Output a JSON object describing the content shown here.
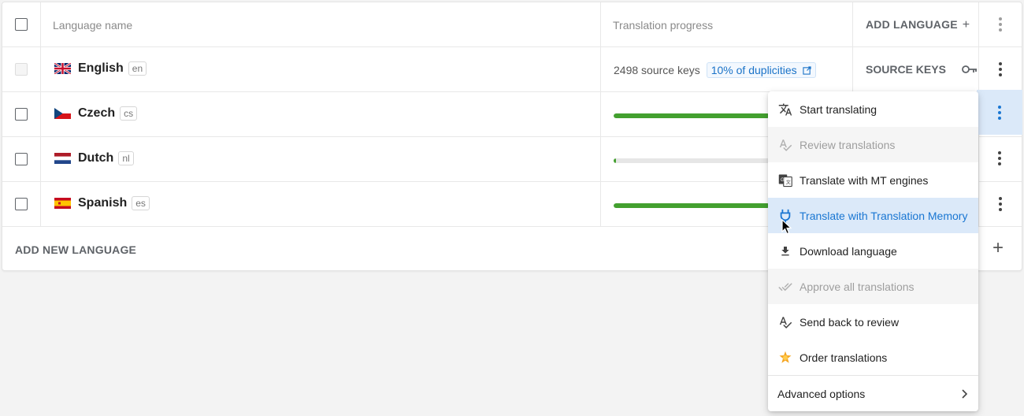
{
  "header": {
    "language_name": "Language name",
    "translation_progress": "Translation progress",
    "add_language": "ADD LANGUAGE",
    "add_icon": "+"
  },
  "rows": [
    {
      "name": "English",
      "code": "en",
      "flag": "uk-flag",
      "source_keys": "2498 source keys",
      "duplicities": "10% of duplicities",
      "source_keys_button": "SOURCE KEYS"
    },
    {
      "name": "Czech",
      "code": "cs",
      "flag": "cz-flag",
      "progress": 0.66
    },
    {
      "name": "Dutch",
      "code": "nl",
      "flag": "nl-flag",
      "progress": 0.01
    },
    {
      "name": "Spanish",
      "code": "es",
      "flag": "es-flag",
      "progress": 0.66
    }
  ],
  "add_new_language": "ADD NEW LANGUAGE",
  "add_new_icon": "+",
  "menu": {
    "items": [
      {
        "label": "Start translating",
        "icon": "translate-icon",
        "state": "normal"
      },
      {
        "label": "Review translations",
        "icon": "spellcheck-icon",
        "state": "disabled"
      },
      {
        "label": "Translate with MT engines",
        "icon": "google-translate-icon",
        "state": "normal"
      },
      {
        "label": "Translate with Translation Memory",
        "icon": "plug-icon",
        "state": "active"
      },
      {
        "label": "Download language",
        "icon": "download-icon",
        "state": "normal"
      },
      {
        "label": "Approve all translations",
        "icon": "double-check-icon",
        "state": "disabled"
      },
      {
        "label": "Send back to review",
        "icon": "spellcheck-icon",
        "state": "normal"
      },
      {
        "label": "Order translations",
        "icon": "star-icon",
        "state": "normal"
      }
    ],
    "advanced": "Advanced options"
  },
  "colors": {
    "accent": "#1976d2",
    "progress": "#43a02f",
    "active_bg": "#dbe9f9"
  }
}
